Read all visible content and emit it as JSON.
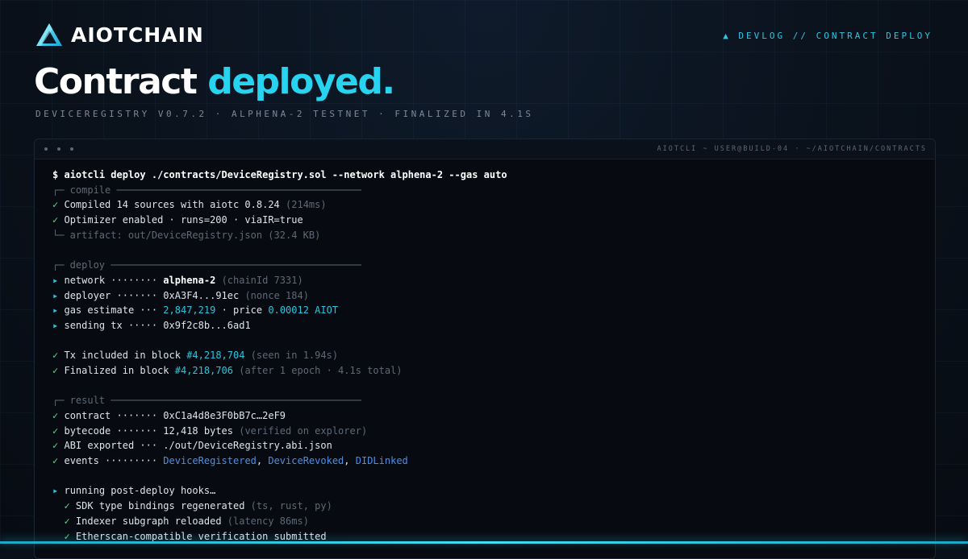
{
  "brand": {
    "name": "AIOTCHAIN"
  },
  "crumb": "▲ DEVLOG // CONTRACT DEPLOY",
  "headline": {
    "main": "Contract",
    "accent": "deployed."
  },
  "subline": "DEVICEREGISTRY V0.7.2 · ALPHENA-2 TESTNET · FINALIZED IN 4.1S",
  "terminal": {
    "path": "AIOTCLI ~ USER@BUILD-04 · ~/AIOTCHAIN/CONTRACTS",
    "command": {
      "prompt": "$",
      "text": "aiotcli deploy ./contracts/DeviceRegistry.sol --network alphena-2 --gas auto"
    },
    "compile": {
      "header": "┌─ compile ──────────────────────────────────────────",
      "line1": {
        "mark": "✓",
        "text": "Compiled 14 sources with aiotc 0.8.24",
        "note": "(214ms)"
      },
      "line2": {
        "mark": "✓",
        "text": "Optimizer enabled · runs=200 · viaIR=true"
      },
      "line3": {
        "text": "└─ artifact: out/DeviceRegistry.json (32.4 KB)"
      }
    },
    "deploy": {
      "header": "┌─ deploy ───────────────────────────────────────────",
      "network": {
        "mark": "▸",
        "key": "network ········",
        "value": "alphena-2",
        "note": "(chainId 7331)"
      },
      "deployer": {
        "mark": "▸",
        "key": "deployer ·······",
        "value": "0xA3F4...91ec",
        "note": "(nonce 184)"
      },
      "gas": {
        "mark": "▸",
        "key": "gas estimate ···",
        "value": "2,847,219",
        "mid": "· price",
        "price": "0.00012 AIOT"
      },
      "sending": {
        "mark": "▸",
        "key": "sending tx ·····",
        "value": "0x9f2c8b...6ad1"
      }
    },
    "inclusion": {
      "included": {
        "mark": "✓",
        "text": "Tx included in block",
        "block": "#4,218,704",
        "note": "(seen in 1.94s)"
      },
      "finalized": {
        "mark": "✓",
        "text": "Finalized in block",
        "block": "#4,218,706",
        "note": "(after 1 epoch · 4.1s total)"
      }
    },
    "result": {
      "header": "┌─ result ───────────────────────────────────────────",
      "contract": {
        "mark": "✓",
        "key": "contract ·······",
        "value": "0xC1a4d8e3F0bB7c…2eF9"
      },
      "bytecode": {
        "mark": "✓",
        "key": "bytecode ·······",
        "value": "12,418 bytes",
        "note": "(verified on explorer)"
      },
      "abi": {
        "mark": "✓",
        "key": "ABI exported ···",
        "value": "./out/DeviceRegistry.abi.json"
      },
      "events": {
        "mark": "✓",
        "key": "events ·········",
        "e1": "DeviceRegistered",
        "sep1": ",",
        "e2": "DeviceRevoked",
        "sep2": ",",
        "e3": "DIDLinked"
      }
    },
    "hooks": {
      "title": {
        "mark": "▸",
        "text": "running post-deploy hooks…"
      },
      "h1": {
        "mark": "✓",
        "text": "SDK type bindings regenerated",
        "note": "(ts, rust, py)"
      },
      "h2": {
        "mark": "✓",
        "text": "Indexer subgraph reloaded",
        "note": "(latency 86ms)"
      },
      "h3": {
        "mark": "✓",
        "text": "Etherscan-compatible verification submitted"
      }
    }
  }
}
